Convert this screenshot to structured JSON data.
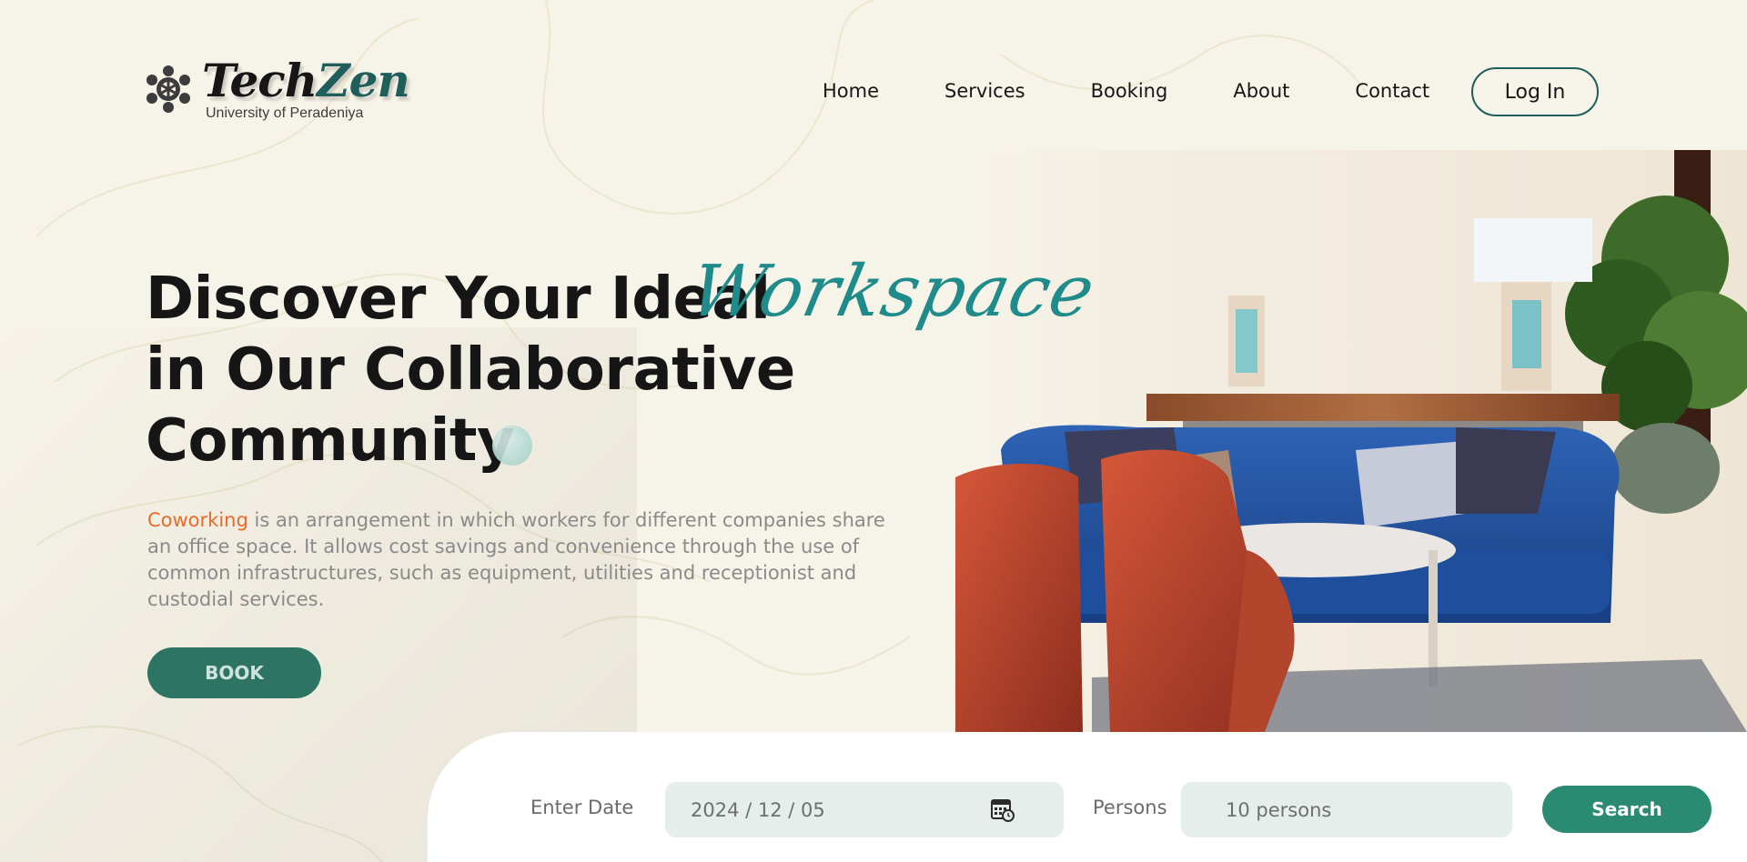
{
  "brand": {
    "name_part1": "Tech",
    "name_part2": "Zen",
    "subtitle": "University of Peradeniya",
    "logo_icon": "molecule-gear-icon"
  },
  "nav": {
    "items": [
      {
        "label": "Home"
      },
      {
        "label": "Services"
      },
      {
        "label": "Booking"
      },
      {
        "label": "About"
      },
      {
        "label": "Contact"
      }
    ],
    "login_label": "Log In"
  },
  "hero": {
    "title_line1": "Discover Your Ideal",
    "script_word": "Workspace",
    "title_line2": "in Our Collaborative",
    "title_line3": "Community",
    "description_highlight": "Coworking",
    "description_rest": " is an arrangement in which workers for different companies share an office space. It allows cost savings and convenience through the use of common infrastructures, such as equipment, utilities and receptionist and custodial services.",
    "book_label": "BOOK",
    "image": "coworking-lounge-photo"
  },
  "search": {
    "date_label": "Enter Date",
    "date_value": "2024 / 12 / 05",
    "date_icon": "calendar-clock-icon",
    "persons_label": "Persons",
    "persons_value": "10 persons",
    "search_label": "Search"
  },
  "colors": {
    "background": "#f6f3e8",
    "brand_teal": "#1f5e5a",
    "accent_orange": "#ea6a2b",
    "script_teal": "#1f8b8a",
    "book_button": "#2d7562",
    "search_button": "#2a8a72",
    "field_bg": "#e6eeeb"
  }
}
